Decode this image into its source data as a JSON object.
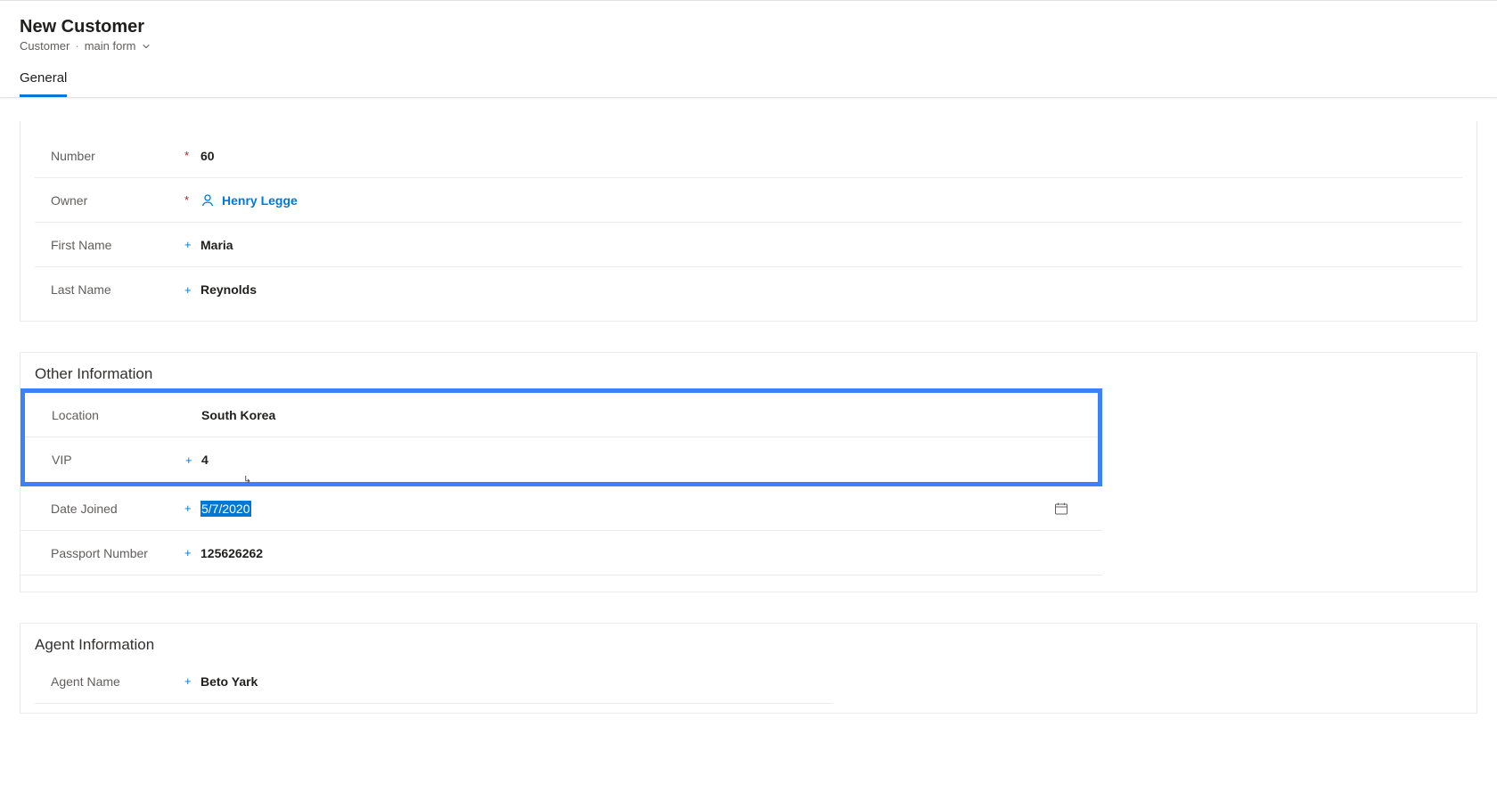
{
  "header": {
    "title": "New Customer",
    "entity": "Customer",
    "form_name": "main form"
  },
  "tabs": [
    {
      "label": "General",
      "active": true
    }
  ],
  "section_general": {
    "fields": {
      "number": {
        "label": "Number",
        "value": "60",
        "required": "required"
      },
      "owner": {
        "label": "Owner",
        "value": "Henry Legge",
        "required": "required"
      },
      "first_name": {
        "label": "First Name",
        "value": "Maria",
        "required": "recommended"
      },
      "last_name": {
        "label": "Last Name",
        "value": "Reynolds",
        "required": "recommended"
      }
    }
  },
  "section_other": {
    "title": "Other Information",
    "fields": {
      "location": {
        "label": "Location",
        "value": "South Korea",
        "required": "none"
      },
      "vip": {
        "label": "VIP",
        "value": "4",
        "required": "recommended"
      },
      "date_joined": {
        "label": "Date Joined",
        "value": "5/7/2020",
        "required": "recommended"
      },
      "passport_number": {
        "label": "Passport Number",
        "value": "125626262",
        "required": "recommended"
      }
    }
  },
  "section_agent": {
    "title": "Agent Information",
    "fields": {
      "agent_name": {
        "label": "Agent Name",
        "value": "Beto Yark",
        "required": "recommended"
      }
    }
  },
  "marks": {
    "required": "*",
    "recommended": "+",
    "none": ""
  }
}
